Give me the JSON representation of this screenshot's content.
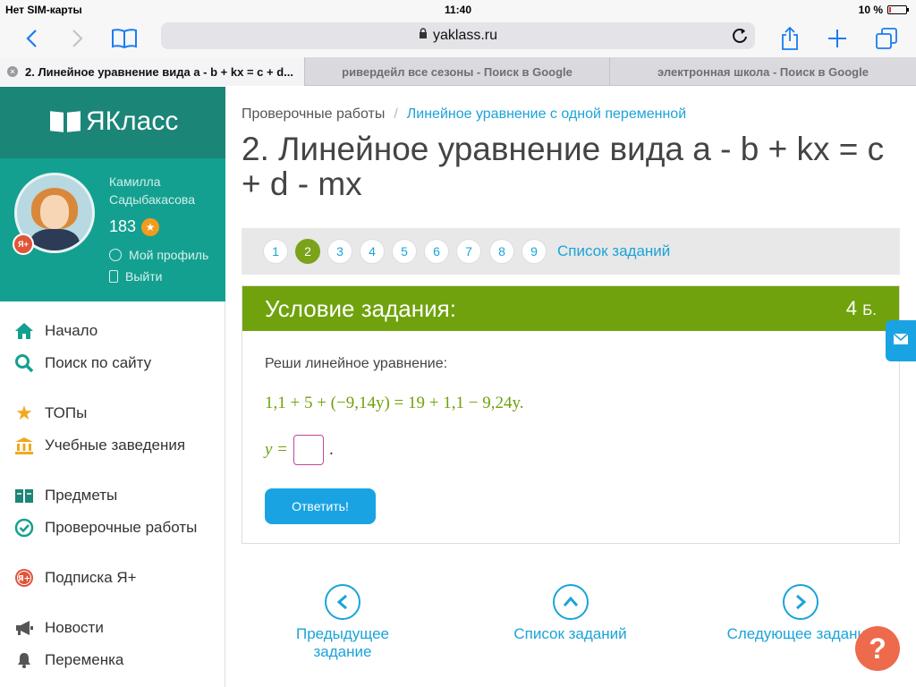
{
  "status": {
    "carrier": "Нет SIM-карты",
    "time": "11:40",
    "battery": "10 %"
  },
  "browser": {
    "url": "yaklass.ru",
    "tabs": [
      {
        "title": "2. Линейное уравнение вида a - b + kx = c + d..."
      },
      {
        "title": "ривердейл все сезоны - Поиск в Google"
      },
      {
        "title": "электронная школа - Поиск в Google"
      }
    ]
  },
  "sidebar": {
    "logo": "ЯКласс",
    "user": {
      "name_line1": "Камилла",
      "name_line2": "Садыбакасова",
      "points": "183"
    },
    "profile_link": "Мой профиль",
    "logout_link": "Выйти",
    "avatar_badge": "Я+",
    "menu": [
      {
        "label": "Начало"
      },
      {
        "label": "Поиск по сайту"
      },
      {
        "label": "ТОПы"
      },
      {
        "label": "Учебные заведения"
      },
      {
        "label": "Предметы"
      },
      {
        "label": "Проверочные работы"
      },
      {
        "label": "Подписка Я+"
      },
      {
        "label": "Новости"
      },
      {
        "label": "Переменка"
      }
    ]
  },
  "breadcrumb": {
    "first": "Проверочные работы",
    "second": "Линейное уравнение с одной переменной"
  },
  "page_title": "2. Линейное уравнение вида a - b + kx = c + d - mx",
  "pager": {
    "pages": [
      "1",
      "2",
      "3",
      "4",
      "5",
      "6",
      "7",
      "8",
      "9"
    ],
    "current": "2",
    "list_link": "Список заданий"
  },
  "task": {
    "header": "Условие задания:",
    "points": "4",
    "points_unit": "Б.",
    "question": "Реши линейное уравнение:",
    "equation": "1,1 + 5 + (−9,14y) = 19 + 1,1 − 9,24y.",
    "answer_label": "y =",
    "answer_suffix": ".",
    "submit": "Ответить!"
  },
  "bottom_nav": {
    "prev": "Предыдущее задание",
    "list": "Список заданий",
    "next": "Следующее задание"
  },
  "colors": {
    "brand_dark": "#1b8578",
    "brand": "#14a090",
    "task_green": "#6fa20c",
    "link_blue": "#1aa3d9",
    "help_orange": "#ee6a4d"
  }
}
